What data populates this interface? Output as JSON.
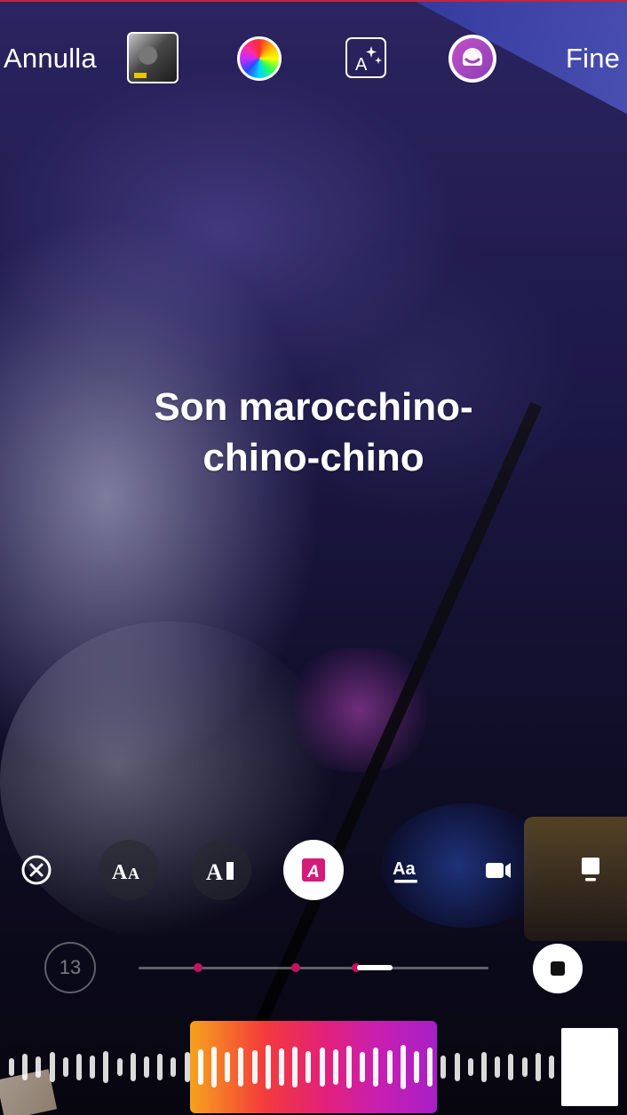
{
  "top_bar": {
    "cancel_label": "Annulla",
    "done_label": "Fine",
    "thumbnail_icon": "cover-thumbnail",
    "color_icon": "color-wheel-icon",
    "effect_icon": "text-effect-icon",
    "sticker_icon": "face-sticker-icon",
    "accent_color": "#c0263d"
  },
  "caption": {
    "line1": "Son marocchino-",
    "line2": "chino-chino"
  },
  "style_row": {
    "items": [
      {
        "name": "remove-icon"
      },
      {
        "name": "font-size-icon",
        "label": "AA"
      },
      {
        "name": "font-style-icon",
        "label": "A"
      },
      {
        "name": "highlight-icon",
        "label": "A",
        "active": true
      },
      {
        "name": "underline-text-icon",
        "label": "Aa"
      },
      {
        "name": "video-camera-icon"
      },
      {
        "name": "sticker-card-icon"
      }
    ]
  },
  "timer": {
    "counter": "13",
    "marker_color": "#c4125f"
  },
  "waveform": {
    "gradient": [
      "#f7a21c",
      "#f33b3b",
      "#e2207a",
      "#c91fae",
      "#a81fc8"
    ]
  }
}
